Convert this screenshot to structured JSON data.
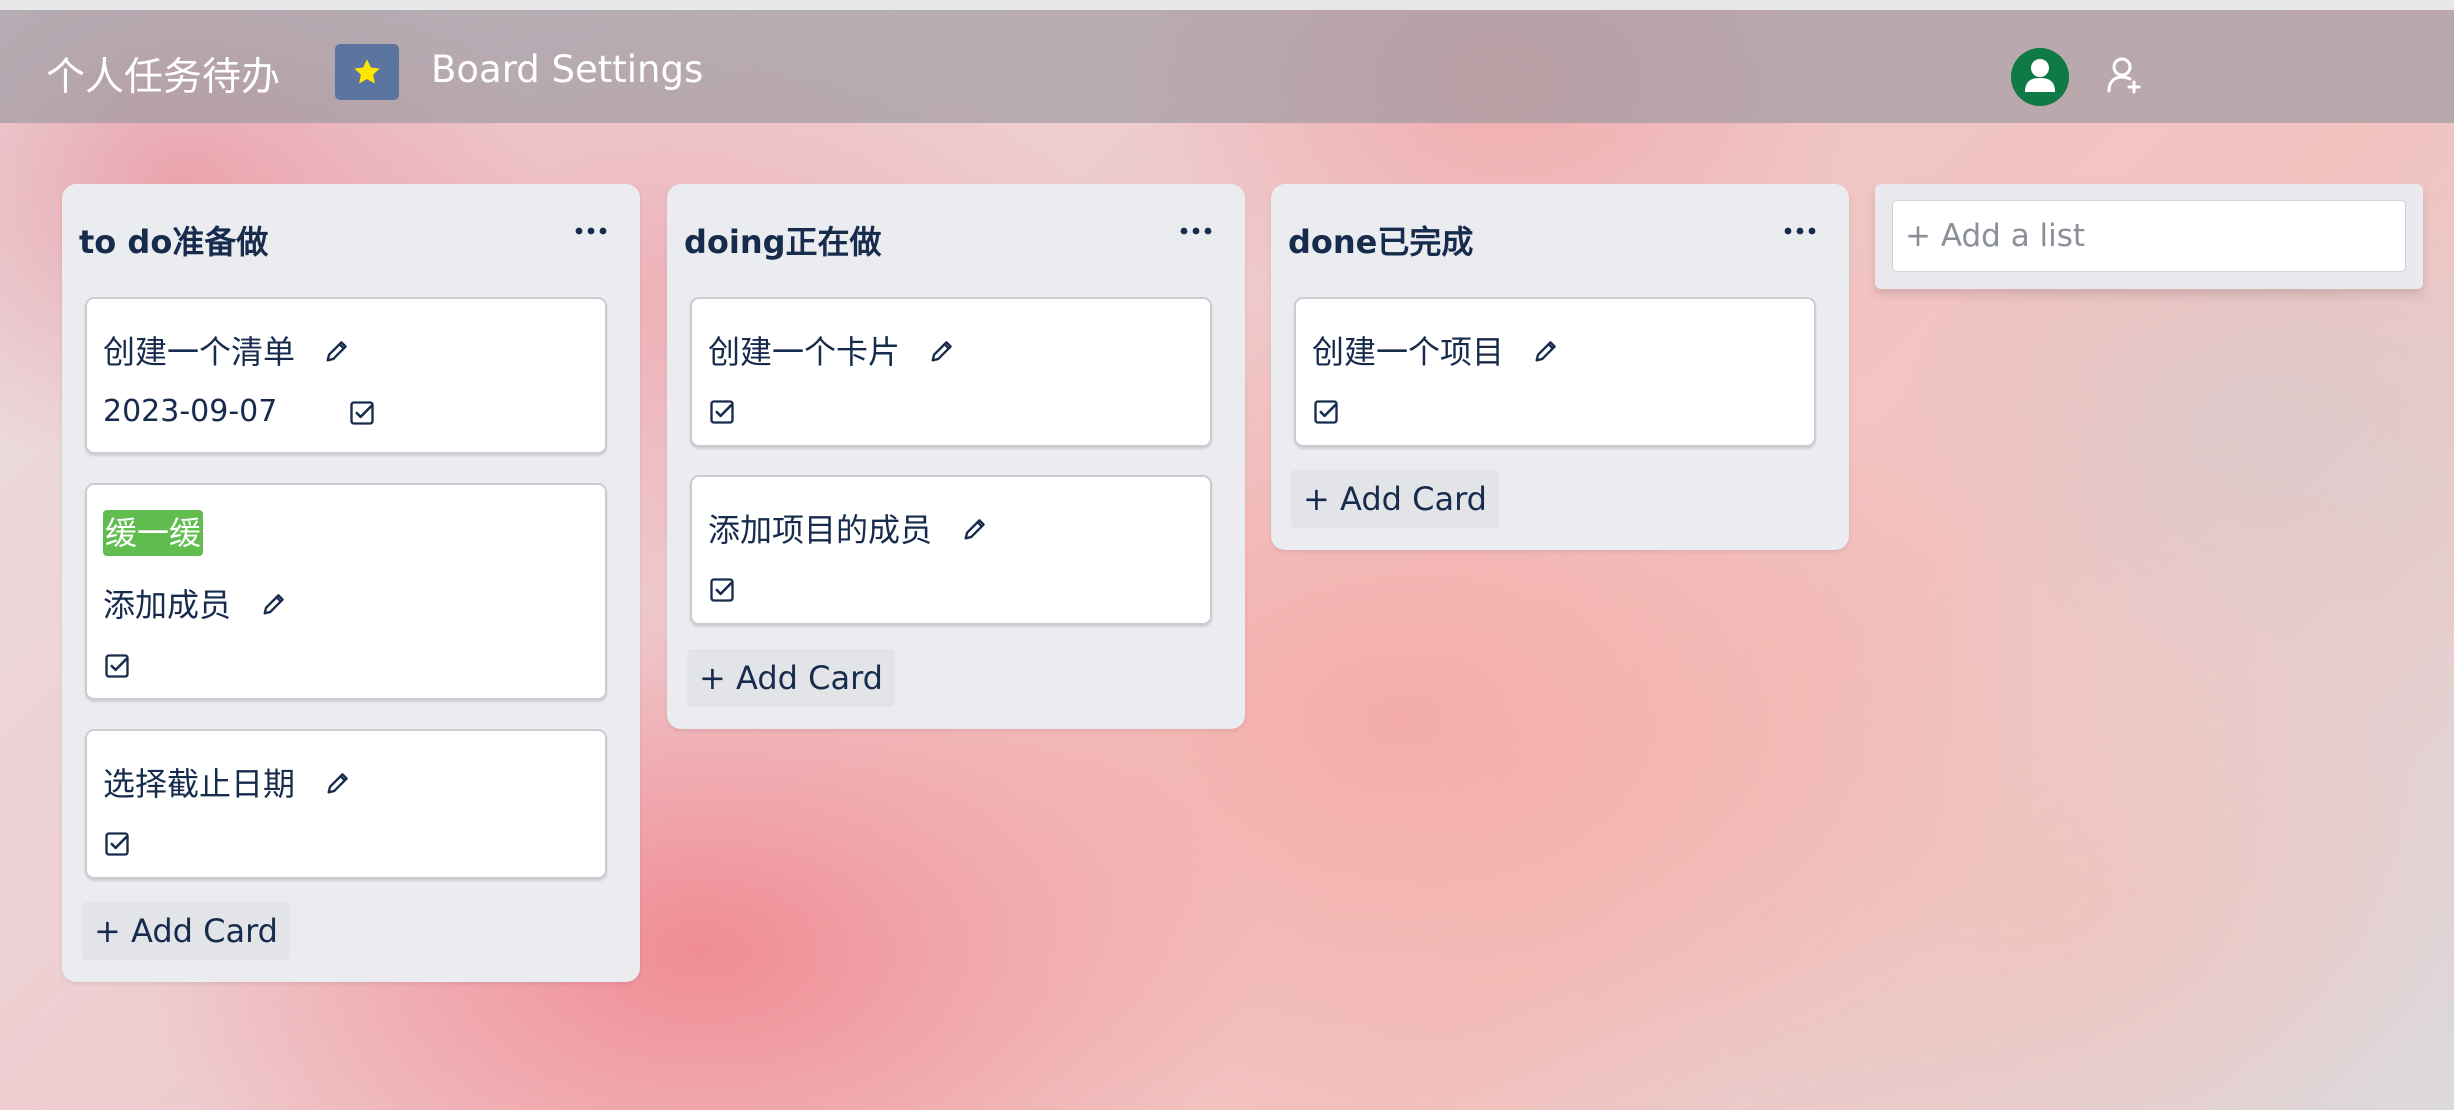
{
  "header": {
    "board_title": "个人任务待办",
    "board_settings_label": "Board Settings",
    "star_icon": "star-icon",
    "avatar_icon": "user-avatar-icon",
    "add_member_icon": "add-user-icon",
    "colors": {
      "star_button": "#5c75a0",
      "avatar": "#107a47",
      "star": "#ffe600"
    }
  },
  "lists": [
    {
      "title": "to do准备做",
      "menu_icon": "ellipsis-icon",
      "cards": [
        {
          "title": "创建一个清单",
          "date": "2023-09-07",
          "label": ""
        },
        {
          "label": "缓一缓",
          "title": "添加成员",
          "date": ""
        },
        {
          "title": "选择截止日期",
          "date": "",
          "label": ""
        }
      ],
      "add_card_label": "+ Add Card"
    },
    {
      "title": "doing正在做",
      "menu_icon": "ellipsis-icon",
      "cards": [
        {
          "title": "创建一个卡片",
          "date": "",
          "label": ""
        },
        {
          "title": "添加项目的成员",
          "date": "",
          "label": ""
        }
      ],
      "add_card_label": "+ Add Card"
    },
    {
      "title": "done已完成",
      "menu_icon": "ellipsis-icon",
      "cards": [
        {
          "title": "创建一个项目",
          "date": "",
          "label": ""
        }
      ],
      "add_card_label": "+ Add Card"
    }
  ],
  "add_list": {
    "placeholder": "+ Add a list",
    "value": ""
  },
  "label_colors": {
    "green": "#61bd4f"
  }
}
